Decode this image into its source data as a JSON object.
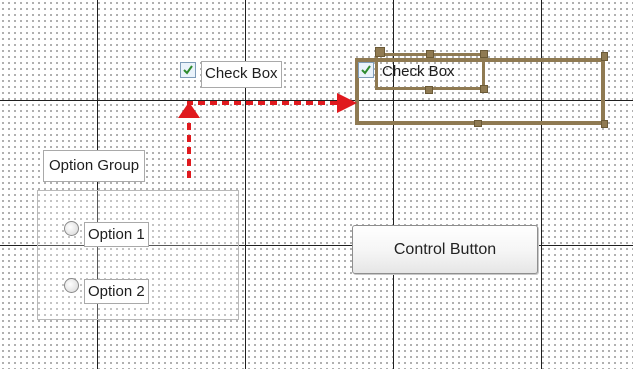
{
  "controls": {
    "option_group": {
      "label": "Option Group",
      "options": [
        {
          "label": "Option 1",
          "selected": false
        },
        {
          "label": "Option 2",
          "selected": false
        }
      ]
    },
    "checkbox_source": {
      "label": "Check Box",
      "checked": true
    },
    "checkbox_target": {
      "label": "Check Box",
      "checked": true
    },
    "control_button": {
      "label": "Control Button"
    }
  },
  "colors": {
    "arrow": "#e0191e",
    "selection_frame": "#8f7a52",
    "gridline": "#1f1f1f",
    "checkmark": "#2e8b2e"
  },
  "icons": {
    "checkbox": "checkmark-icon",
    "radio": "radio-button-icon",
    "arrow": "red-dashed-arrow-icon"
  }
}
